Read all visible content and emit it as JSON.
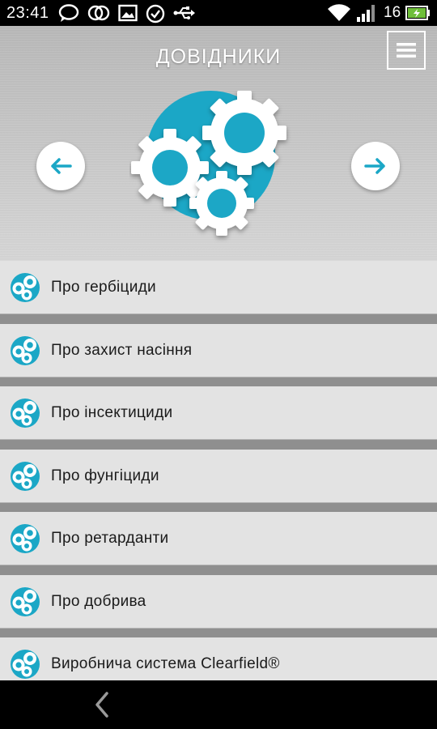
{
  "status_bar": {
    "time": "23:41",
    "battery_level": "16",
    "icons": [
      "chat-bubble-icon",
      "circles-icon",
      "image-icon",
      "check-circle-icon",
      "usb-icon",
      "wifi-icon",
      "signal-icon",
      "battery-charging-icon"
    ]
  },
  "header": {
    "title": "ДОВІДНИКИ",
    "accent_color": "#1ba7c6"
  },
  "list": {
    "items": [
      {
        "label": "Про гербіциди"
      },
      {
        "label": "Про захист насіння"
      },
      {
        "label": "Про інсектициди"
      },
      {
        "label": "Про фунгіциди"
      },
      {
        "label": "Про ретарданти"
      },
      {
        "label": "Про добрива"
      },
      {
        "label": "Виробнича система Clearfield®"
      }
    ]
  }
}
